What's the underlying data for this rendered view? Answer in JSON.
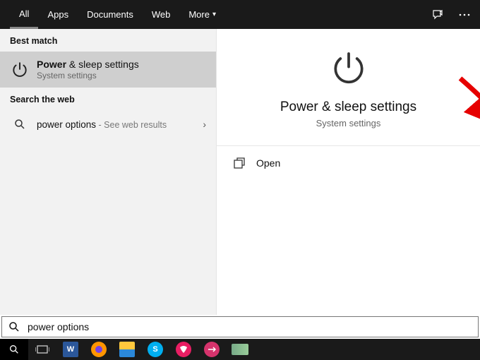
{
  "tabs": {
    "all": "All",
    "apps": "Apps",
    "documents": "Documents",
    "web": "Web",
    "more": "More"
  },
  "left": {
    "best_match_header": "Best match",
    "best_match": {
      "title_bold": "Power",
      "title_rest": " & sleep settings",
      "subtitle": "System settings"
    },
    "web_header": "Search the web",
    "web_result": {
      "query": "power options",
      "suffix": " - See web results"
    }
  },
  "detail": {
    "title": "Power & sleep settings",
    "subtitle": "System settings",
    "open_label": "Open"
  },
  "search": {
    "value": "power options"
  },
  "taskbar": {
    "items": [
      "search",
      "task-view",
      "word",
      "firefox",
      "file-explorer",
      "skype",
      "mailbird",
      "gateway",
      "camera"
    ],
    "word_letter": "W",
    "skype_letter": "S"
  }
}
